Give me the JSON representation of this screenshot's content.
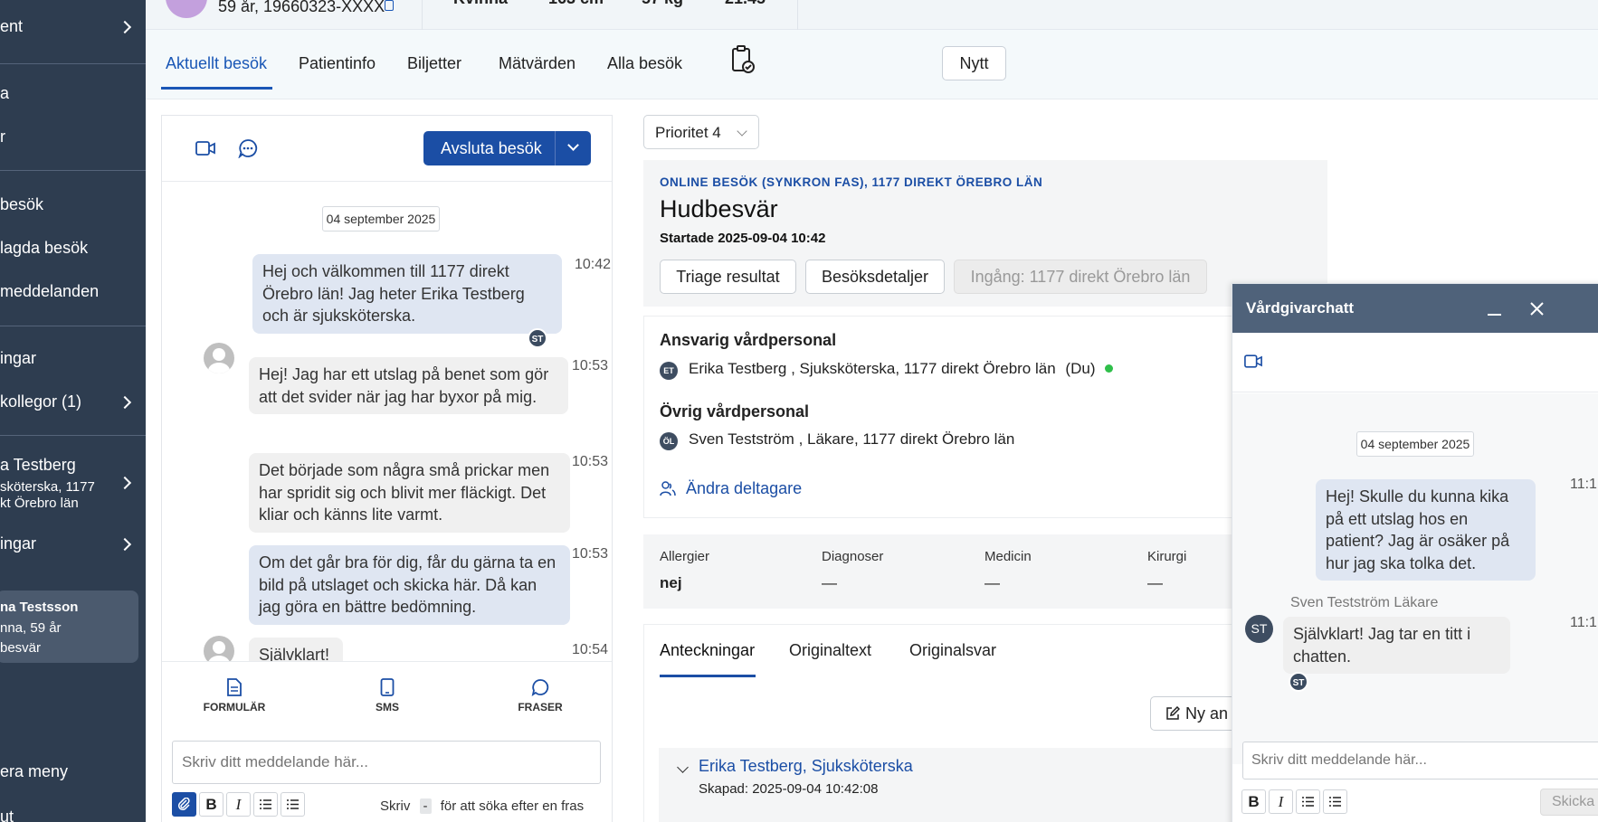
{
  "sidebar": {
    "items": [
      {
        "label": "ent"
      },
      {
        "label": "a"
      },
      {
        "label": "r"
      },
      {
        "label": "besök"
      },
      {
        "label": "lagda besök"
      },
      {
        "label": "meddelanden"
      },
      {
        "label": "ingar"
      },
      {
        "label": "kollegor (1)"
      },
      {
        "label": "ingar"
      }
    ],
    "profile": {
      "name": "a Testberg",
      "line2": "sköterska, 1177",
      "line3": "kt Örebro län"
    },
    "current_patient": {
      "name": "na Testsson",
      "line2": "nna, 59 år",
      "line3": "besvär"
    },
    "bottom_menu": "era meny",
    "bottom_last": "ut"
  },
  "header": {
    "patient_age_pnr": "59 år, 19660323-XXXX",
    "gender": "Kvinna",
    "height": "163 cm",
    "weight": "57 kg",
    "bmi": "21.45"
  },
  "tabs": {
    "items": [
      {
        "label": "Aktuellt besök"
      },
      {
        "label": "Patientinfo"
      },
      {
        "label": "Biljetter"
      },
      {
        "label": "Mätvärden"
      },
      {
        "label": "Alla besök"
      }
    ],
    "new_button": "Nytt"
  },
  "chat": {
    "end_visit": "Avsluta besök",
    "date": "04 september 2025",
    "messages": [
      {
        "text": "Hej och välkommen till 1177 direkt Örebro län! Jag heter Erika Testberg och är sjuksköterska.",
        "time": "10:42",
        "badge": "ST"
      },
      {
        "text": "Hej! Jag har ett utslag på benet som gör att det svider när jag har byxor på mig.",
        "time": "10:53"
      },
      {
        "text": "Det började som några små prickar men har spridit sig och blivit mer fläckigt. Det kliar och känns lite varmt.",
        "time": "10:53"
      },
      {
        "text": "Om det går bra för dig, får du gärna ta en bild på utslaget och skicka här. Då kan jag göra en bättre bedömning.",
        "time": "10:53"
      },
      {
        "text": "Självklart!",
        "time": "10:54"
      }
    ],
    "tools": [
      {
        "label": "FORMULÄR"
      },
      {
        "label": "SMS"
      },
      {
        "label": "FRASER"
      }
    ],
    "input_placeholder": "Skriv ditt meddelande här...",
    "hint_pre": "Skriv",
    "hint_key": "-",
    "hint_post": "för att söka efter en fras"
  },
  "visit": {
    "priority": "Prioritet 4",
    "type_line": "ONLINE BESÖK (SYNKRON FAS), 1177 DIREKT ÖREBRO LÄN",
    "title": "Hudbesvär",
    "started": "Startade 2025-09-04 10:42",
    "buttons": {
      "triage": "Triage resultat",
      "details": "Besöksdetaljer",
      "entry": "Ingång: 1177 direkt Örebro län"
    },
    "responsible_heading": "Ansvarig vårdpersonal",
    "responsible": {
      "initials": "ET",
      "text": "Erika Testberg , Sjuksköterska, 1177 direkt Örebro län",
      "you": "(Du)"
    },
    "other_heading": "Övrig vårdpersonal",
    "other": {
      "initials": "ÖL",
      "text": "Sven Testström , Läkare, 1177 direkt Örebro län"
    },
    "change_participants": "Ändra deltagare",
    "medical": [
      {
        "label": "Allergier",
        "value": "nej"
      },
      {
        "label": "Diagnoser",
        "value": "—"
      },
      {
        "label": "Medicin",
        "value": "—"
      },
      {
        "label": "Kirurgi",
        "value": "—"
      }
    ],
    "note_tabs": [
      {
        "label": "Anteckningar"
      },
      {
        "label": "Originaltext"
      },
      {
        "label": "Originalsvar"
      }
    ],
    "new_note": "Ny an",
    "note": {
      "author": "Erika Testberg, Sjuksköterska",
      "created": "Skapad: 2025-09-04 10:42:08"
    }
  },
  "staff_chat": {
    "title": "Vårdgivarchatt",
    "date": "04 september 2025",
    "messages": [
      {
        "text": "Hej! Skulle du kunna kika på ett utslag hos en patient? Jag är osäker på hur jag ska tolka det.",
        "time": "11:1"
      },
      {
        "sender": "Sven Testström Läkare",
        "initials": "ST",
        "text": "Självklart! Jag tar en titt i chatten.",
        "time": "11:1",
        "badge": "ST"
      }
    ],
    "input_placeholder": "Skriv ditt meddelande här...",
    "send": "Skicka"
  },
  "colors": {
    "primary": "#1b4ea5",
    "sidebar": "#2e3d50",
    "online": "#2fbf4a"
  }
}
